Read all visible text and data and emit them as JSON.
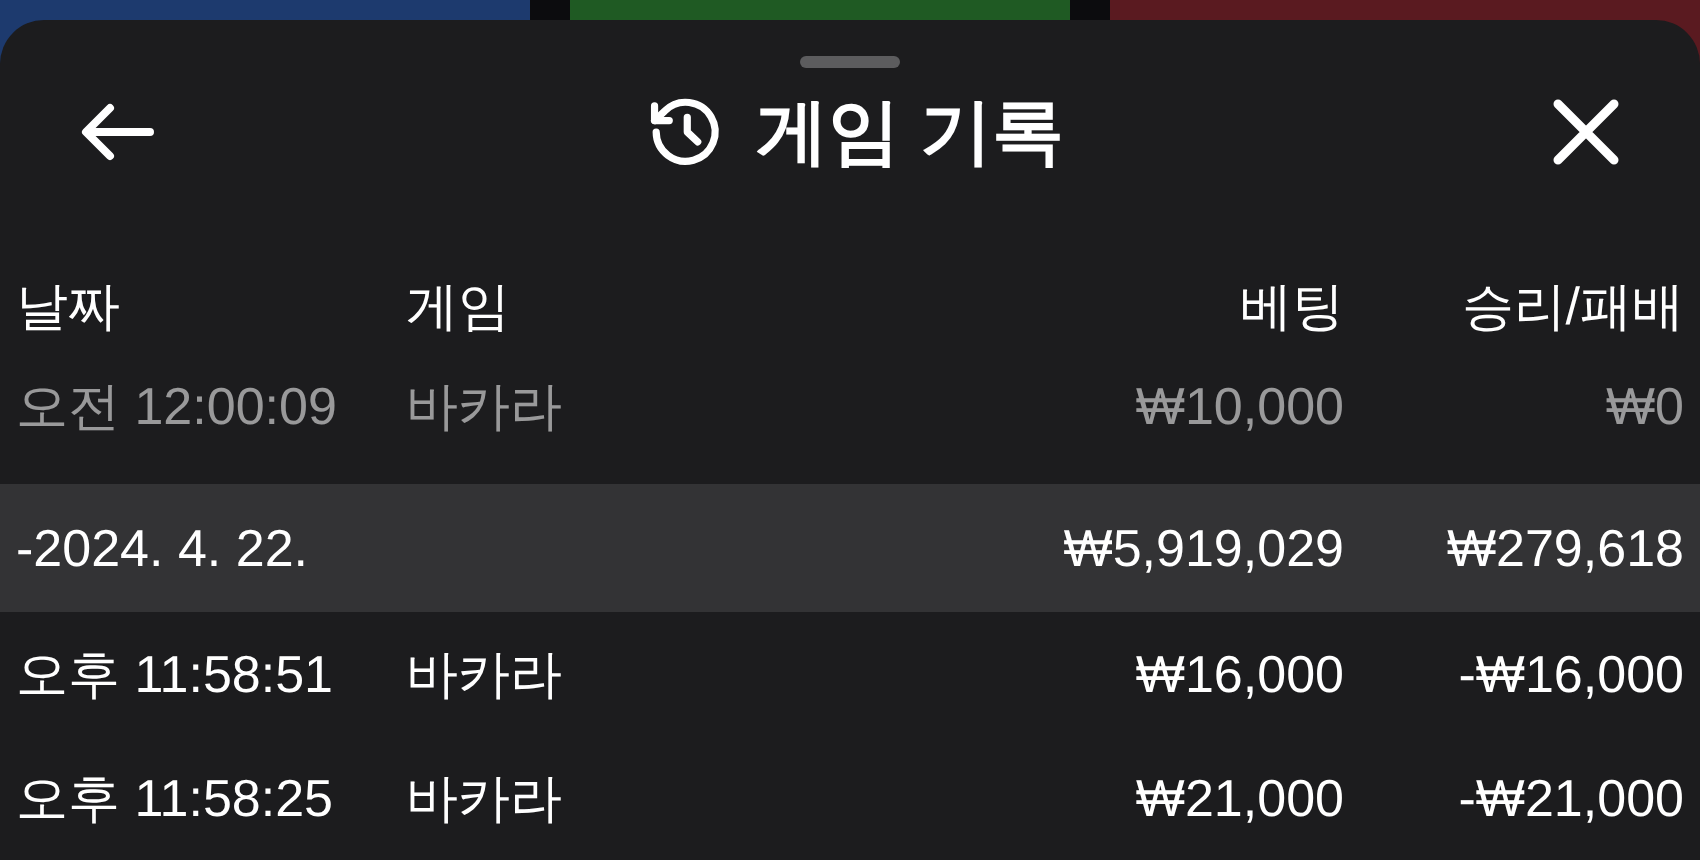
{
  "background": {
    "tiles": [
      {
        "color": "#1d3a6e"
      },
      {
        "color": "#1f5a23"
      },
      {
        "color": "#5a1a20"
      }
    ]
  },
  "sheet": {
    "title": "게임 기록",
    "columns": [
      "날짜",
      "게임",
      "베팅",
      "승리/패배"
    ],
    "rows": [
      {
        "kind": "entry",
        "dimmed": true,
        "time": "오전 12:00:09",
        "game": "바카라",
        "bet": "₩10,000",
        "result": "₩0"
      },
      {
        "kind": "date",
        "dimmed": false,
        "date": "-2024. 4. 22.",
        "bet": "₩5,919,029",
        "result": "₩279,618"
      },
      {
        "kind": "entry",
        "dimmed": false,
        "time": "오후 11:58:51",
        "game": "바카라",
        "bet": "₩16,000",
        "result": "-₩16,000"
      },
      {
        "kind": "entry",
        "dimmed": false,
        "time": "오후 11:58:25",
        "game": "바카라",
        "bet": "₩21,000",
        "result": "-₩21,000"
      }
    ]
  }
}
